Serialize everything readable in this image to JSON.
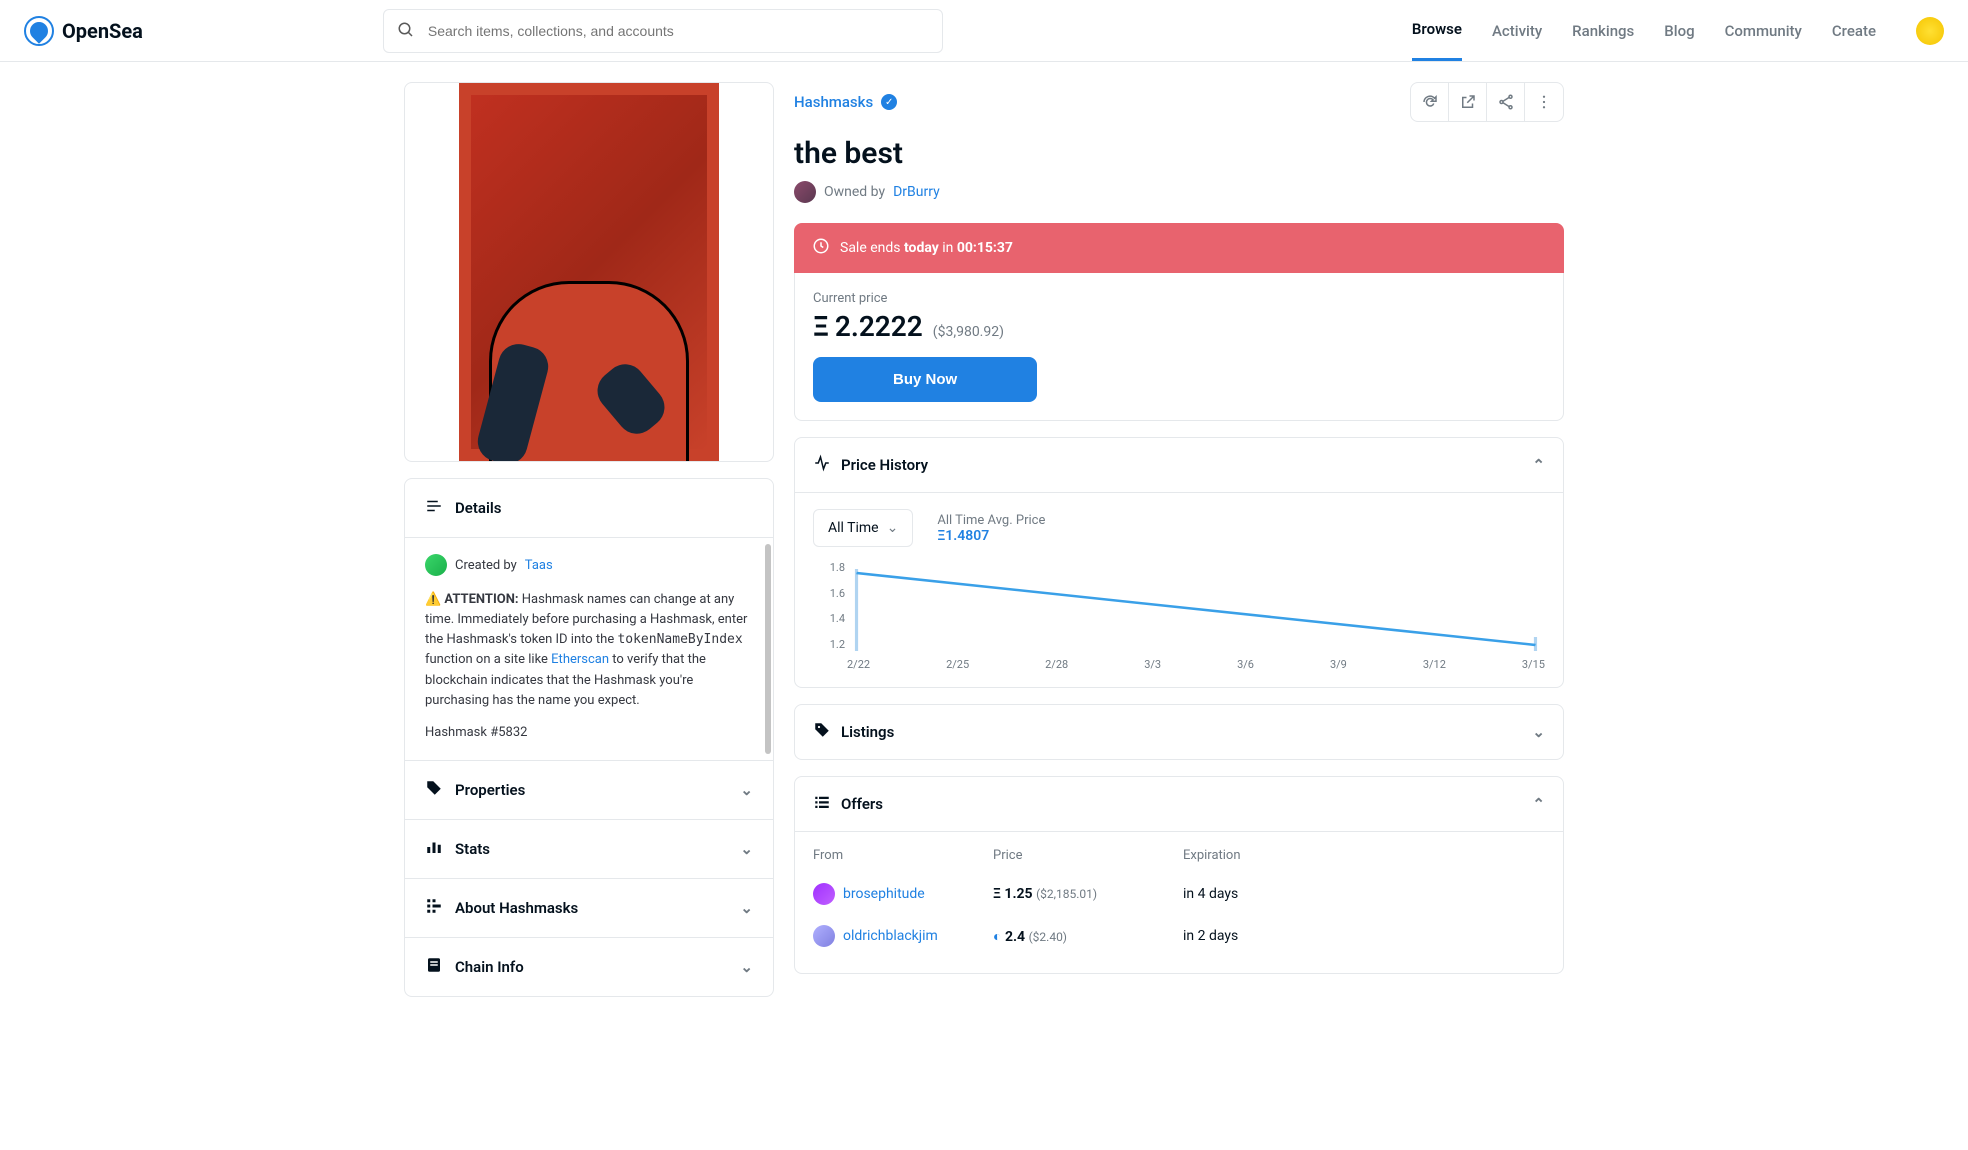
{
  "brand": "OpenSea",
  "search": {
    "placeholder": "Search items, collections, and accounts"
  },
  "nav": {
    "browse": "Browse",
    "activity": "Activity",
    "rankings": "Rankings",
    "blog": "Blog",
    "community": "Community",
    "create": "Create"
  },
  "collection": {
    "name": "Hashmasks"
  },
  "item": {
    "title": "the best",
    "owned_by_label": "Owned by",
    "owner": "DrBurry",
    "sale_prefix": "Sale ends ",
    "sale_emph": "today",
    "sale_in": " in ",
    "sale_countdown": "00:15:37",
    "current_price_label": "Current price",
    "price_eth": "2.2222",
    "price_usd": "($3,980.92)",
    "buy_label": "Buy Now"
  },
  "details": {
    "header": "Details",
    "created_by_label": "Created by ",
    "creator": "Taas",
    "warning_prefix": "⚠️ ",
    "warning_bold": "ATTENTION:",
    "warning_text_1": " Hashmask names can change at any time. Immediately before purchasing a Hashmask, enter the Hashmask's token ID into the ",
    "code": "tokenNameByIndex",
    "warning_text_2": " function on a site like ",
    "etherscan": "Etherscan",
    "warning_text_3": " to verify that the blockchain indicates that the Hashmask you're purchasing has the name you expect.",
    "token_line": "Hashmask #5832"
  },
  "panels": {
    "properties": "Properties",
    "stats": "Stats",
    "about": "About Hashmasks",
    "chain": "Chain Info"
  },
  "history": {
    "header": "Price History",
    "range": "All Time",
    "avg_label": "All Time Avg. Price",
    "avg_value": "Ξ1.4807"
  },
  "listings": {
    "header": "Listings"
  },
  "offers": {
    "header": "Offers",
    "cols": {
      "from": "From",
      "price": "Price",
      "exp": "Expiration"
    },
    "rows": [
      {
        "from": "brosephitude",
        "sym": "Ξ",
        "amount": "1.25",
        "usd": "($2,185.01)",
        "exp": "in 4 days",
        "avatar_color": "linear-gradient(135deg,#a030ff,#c060ff)"
      },
      {
        "from": "oldrichblackjim",
        "sym": "weth",
        "amount": "2.4",
        "usd": "($2.40)",
        "exp": "in 2 days",
        "avatar_color": "linear-gradient(135deg,#b0b0ff,#8080e0)"
      }
    ]
  },
  "chart_data": {
    "type": "line",
    "title": "Price History",
    "xlabel": "",
    "ylabel": "",
    "ylim": [
      1.2,
      1.8
    ],
    "y_ticks": [
      "1.8",
      "1.6",
      "1.4",
      "1.2"
    ],
    "x_ticks": [
      "2/22",
      "2/25",
      "2/28",
      "3/3",
      "3/6",
      "3/9",
      "3/12",
      "3/15"
    ],
    "series": [
      {
        "name": "price",
        "x": [
          "2/20",
          "3/15"
        ],
        "y": [
          1.72,
          1.24
        ]
      }
    ]
  }
}
